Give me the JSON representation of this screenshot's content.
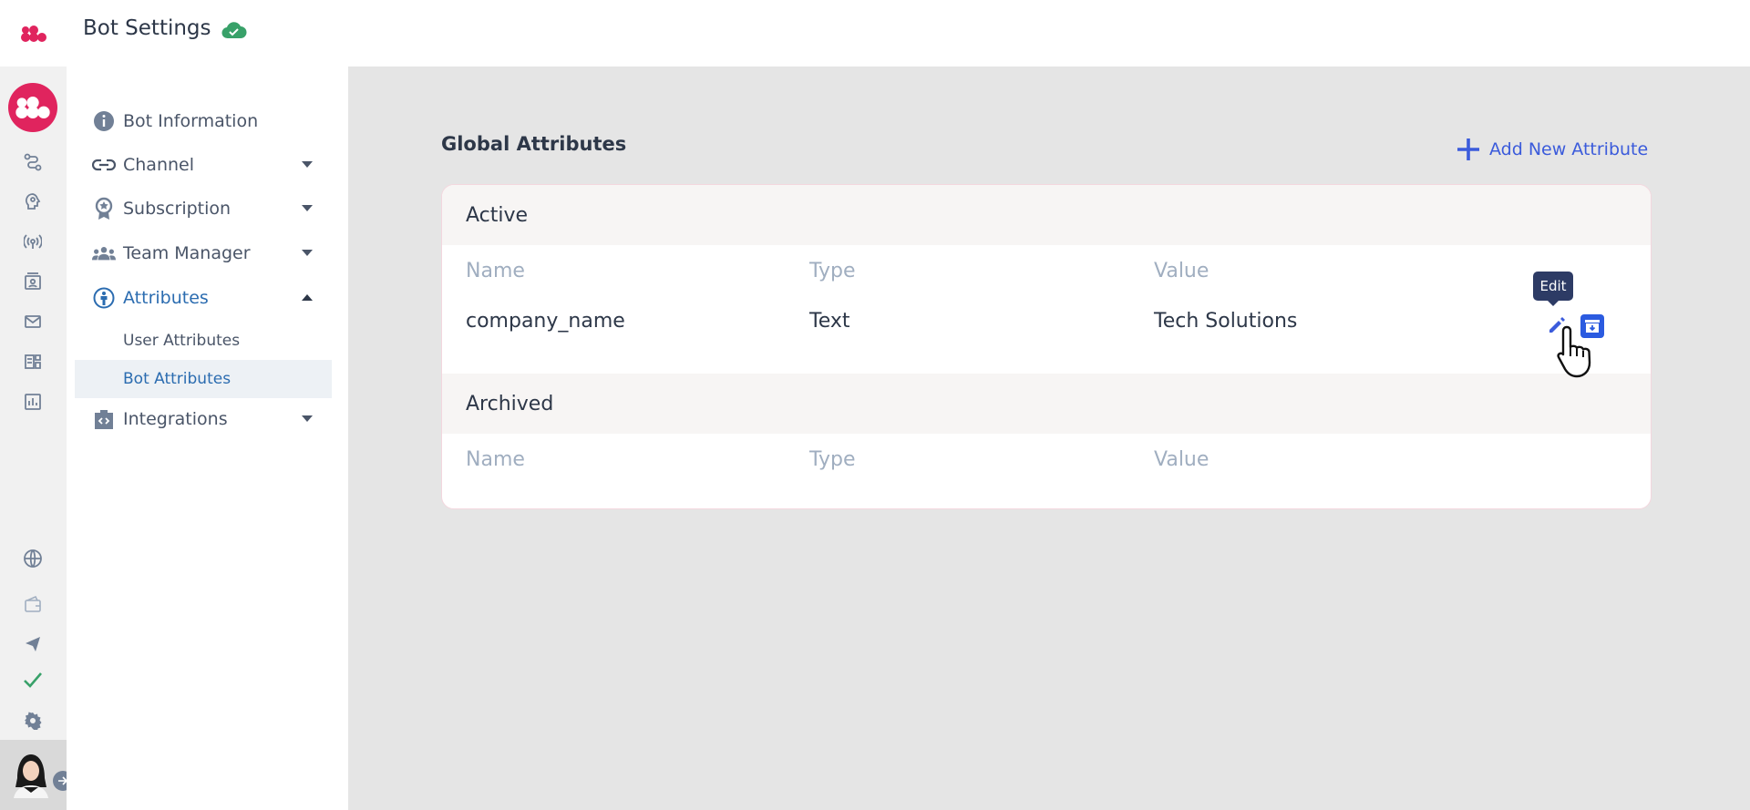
{
  "header": {
    "title": "Bot Settings",
    "status_icon": "cloud-check-icon",
    "status_color": "#38a169"
  },
  "rail": {
    "brand_color": "#e0245e",
    "top_icons": [
      "flow-icon",
      "brain-icon",
      "broadcast-icon",
      "contacts-icon",
      "mail-icon",
      "reports-icon",
      "analytics-icon"
    ],
    "bottom_icons": [
      "globe-icon",
      "wallet-icon",
      "send-icon",
      "check-icon",
      "gear-icon"
    ]
  },
  "sidenav": {
    "items": [
      {
        "label": "Bot Information",
        "icon": "info-icon"
      },
      {
        "label": "Channel",
        "icon": "link-icon"
      },
      {
        "label": "Subscription",
        "icon": "badge-icon"
      },
      {
        "label": "Team Manager",
        "icon": "team-icon"
      },
      {
        "label": "Attributes",
        "icon": "attributes-icon"
      },
      {
        "label": "Integrations",
        "icon": "integrations-icon"
      }
    ],
    "sub_items": [
      "User Attributes",
      "Bot Attributes"
    ]
  },
  "main": {
    "title": "Global Attributes",
    "add_label": "Add New Attribute",
    "accent": "#3b5bdb",
    "active": {
      "title": "Active",
      "columns": [
        "Name",
        "Type",
        "Value"
      ],
      "rows": [
        {
          "name": "company_name",
          "type": "Text",
          "value": "Tech Solutions"
        }
      ]
    },
    "archived": {
      "title": "Archived",
      "columns": [
        "Name",
        "Type",
        "Value"
      ]
    },
    "tooltip": "Edit"
  }
}
